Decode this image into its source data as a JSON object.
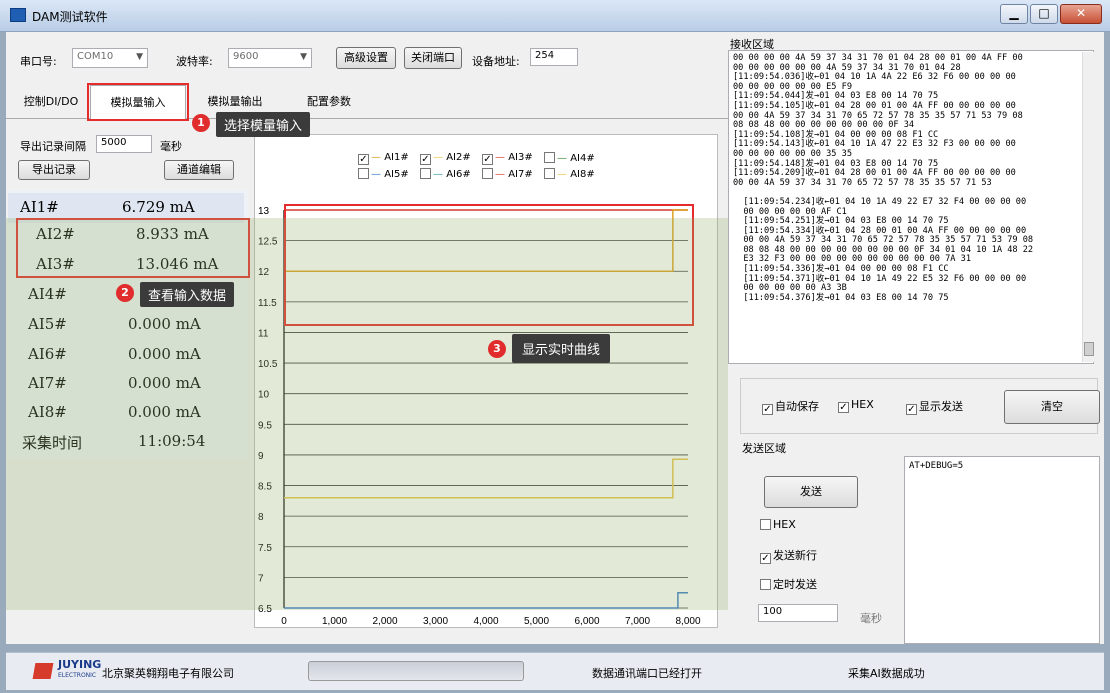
{
  "window": {
    "title": "DAM测试软件",
    "min": "▁",
    "max": "□",
    "close": "✕"
  },
  "toolbar": {
    "port_label": "串口号:",
    "port_value": "COM10",
    "baud_label": "波特率:",
    "baud_value": "9600",
    "advanced": "高级设置",
    "close_port": "关闭端口",
    "device_addr_label": "设备地址:",
    "device_addr_value": "254"
  },
  "tabs": [
    {
      "label": "控制DI/DO"
    },
    {
      "label": "模拟量输入"
    },
    {
      "label": "模拟量输出"
    },
    {
      "label": "配置参数"
    }
  ],
  "export": {
    "interval_label": "导出记录间隔",
    "interval_value": "5000",
    "unit": "毫秒",
    "export_btn": "导出记录",
    "channel_btn": "通道编辑"
  },
  "readings": [
    {
      "name": "AI1#",
      "value": "6.729 mA"
    },
    {
      "name": "AI2#",
      "value": "8.933 mA"
    },
    {
      "name": "AI3#",
      "value": "13.046 mA"
    },
    {
      "name": "AI4#",
      "value": ""
    },
    {
      "name": "AI5#",
      "value": "0.000 mA"
    },
    {
      "name": "AI6#",
      "value": "0.000 mA"
    },
    {
      "name": "AI7#",
      "value": "0.000 mA"
    },
    {
      "name": "AI8#",
      "value": "0.000 mA"
    }
  ],
  "collect_time": {
    "label": "采集时间",
    "value": "11:09:54"
  },
  "callouts": [
    {
      "num": "1",
      "text": "选择模量输入"
    },
    {
      "num": "2",
      "text": "查看输入数据"
    },
    {
      "num": "3",
      "text": "显示实时曲线"
    }
  ],
  "legend": [
    {
      "name": "AI1#",
      "color": "#d4a017",
      "checked": true
    },
    {
      "name": "AI2#",
      "color": "#e8c34a",
      "checked": true
    },
    {
      "name": "AI3#",
      "color": "#d63a2a",
      "checked": true
    },
    {
      "name": "AI4#",
      "color": "#3a8a3a",
      "checked": false
    },
    {
      "name": "AI5#",
      "color": "#3a7acc",
      "checked": false
    },
    {
      "name": "AI6#",
      "color": "#3a9aaa",
      "checked": false
    },
    {
      "name": "AI7#",
      "color": "#d63a2a",
      "checked": false
    },
    {
      "name": "AI8#",
      "color": "#e8c34a",
      "checked": false
    }
  ],
  "chart_data": {
    "type": "line",
    "y_ticks": [
      "13",
      "12.5",
      "12",
      "11.5",
      "11",
      "10.5",
      "10",
      "9.5",
      "9",
      "8.5",
      "8",
      "7.5",
      "7",
      "6.5"
    ],
    "x_ticks": [
      "0",
      "1,000",
      "2,000",
      "3,000",
      "4,000",
      "5,000",
      "6,000",
      "7,000",
      "8,000"
    ],
    "ylim": [
      6.5,
      13
    ],
    "xlim": [
      0,
      8000
    ],
    "series": [
      {
        "color": "#d63a2a",
        "x": [
          0,
          7700,
          7700,
          8000
        ],
        "y": [
          13,
          13,
          13.0,
          13.0
        ]
      },
      {
        "color": "#e0a020",
        "x": [
          0,
          7700,
          7700,
          8000
        ],
        "y": [
          12,
          12,
          13,
          13
        ]
      },
      {
        "color": "#e8c34a",
        "x": [
          0,
          7700,
          7700,
          8000
        ],
        "y": [
          8.3,
          8.3,
          8.93,
          8.93
        ]
      },
      {
        "color": "#3a7acc",
        "x": [
          0,
          7800,
          7800,
          8000
        ],
        "y": [
          6.5,
          6.5,
          6.75,
          6.75
        ]
      }
    ]
  },
  "recv": {
    "label": "接收区域",
    "lines": [
      "00 00 00 00 4A 59 37 34 31 70 01 04 28 00 01 00 4A FF 00",
      "00 00 00 00 00 00 4A 59 37 34 31 70 01 04 28",
      "[11:09:54.036]收←01 04 10 1A 4A 22 E6 32 F6 00 00 00 00",
      "00 00 00 00 00 00 E5 F9",
      "[11:09:54.044]发→01 04 03 E8 00 14 70 75",
      "[11:09:54.105]收←01 04 28 00 01 00 4A FF 00 00 00 00 00",
      "00 00 4A 59 37 34 31 70 65 72 57 78 35 35 57 71 53 79 08",
      "08 08 48 00 00 00 00 00 00 00 0F 34",
      "[11:09:54.108]发→01 04 00 00 00 08 F1 CC",
      "[11:09:54.143]收←01 04 10 1A 47 22 E3 32 F3 00 00 00 00",
      "00 00 00 00 00 00 35 35",
      "[11:09:54.148]发→01 04 03 E8 00 14 70 75",
      "[11:09:54.209]收←01 04 28 00 01 00 4A FF 00 00 00 00 00",
      "00 00 4A 59 37 34 31 70 65 72 57 78 35 35 57 71 53",
      "",
      "  [11:09:54.234]收←01 04 10 1A 49 22 E7 32 F4 00 00 00 00",
      "  00 00 00 00 00 AF C1",
      "  [11:09:54.251]发→01 04 03 E8 00 14 70 75",
      "  [11:09:54.334]收←01 04 28 00 01 00 4A FF 00 00 00 00 00",
      "  00 00 4A 59 37 34 31 70 65 72 57 78 35 35 57 71 53 79 08",
      "  08 08 48 00 00 00 00 00 00 00 00 0F 34 01 04 10 1A 48 22",
      "  E3 32 F3 00 00 00 00 00 00 00 00 00 00 7A 31",
      "  [11:09:54.336]发→01 04 00 00 00 08 F1 CC",
      "  [11:09:54.371]收←01 04 10 1A 49 22 E5 32 F6 00 00 00 00",
      "  00 00 00 00 00 A3 3B",
      "  [11:09:54.376]发→01 04 03 E8 00 14 70 75"
    ]
  },
  "options": {
    "auto_save": "自动保存",
    "hex": "HEX",
    "show_send": "显示发送",
    "clear": "清空"
  },
  "send": {
    "label": "发送区域",
    "text": "AT+DEBUG=5",
    "send_btn": "发送",
    "hex": "HEX",
    "newline": "发送新行",
    "timed": "定时发送",
    "interval_value": "100",
    "interval_unit": "毫秒"
  },
  "status": {
    "company": "北京聚英翱翔电子有限公司",
    "logo_text": "JUYING",
    "logo_sub": "ELECTRONIC",
    "port_status": "数据通讯端口已经打开",
    "collect_status": "采集AI数据成功"
  }
}
